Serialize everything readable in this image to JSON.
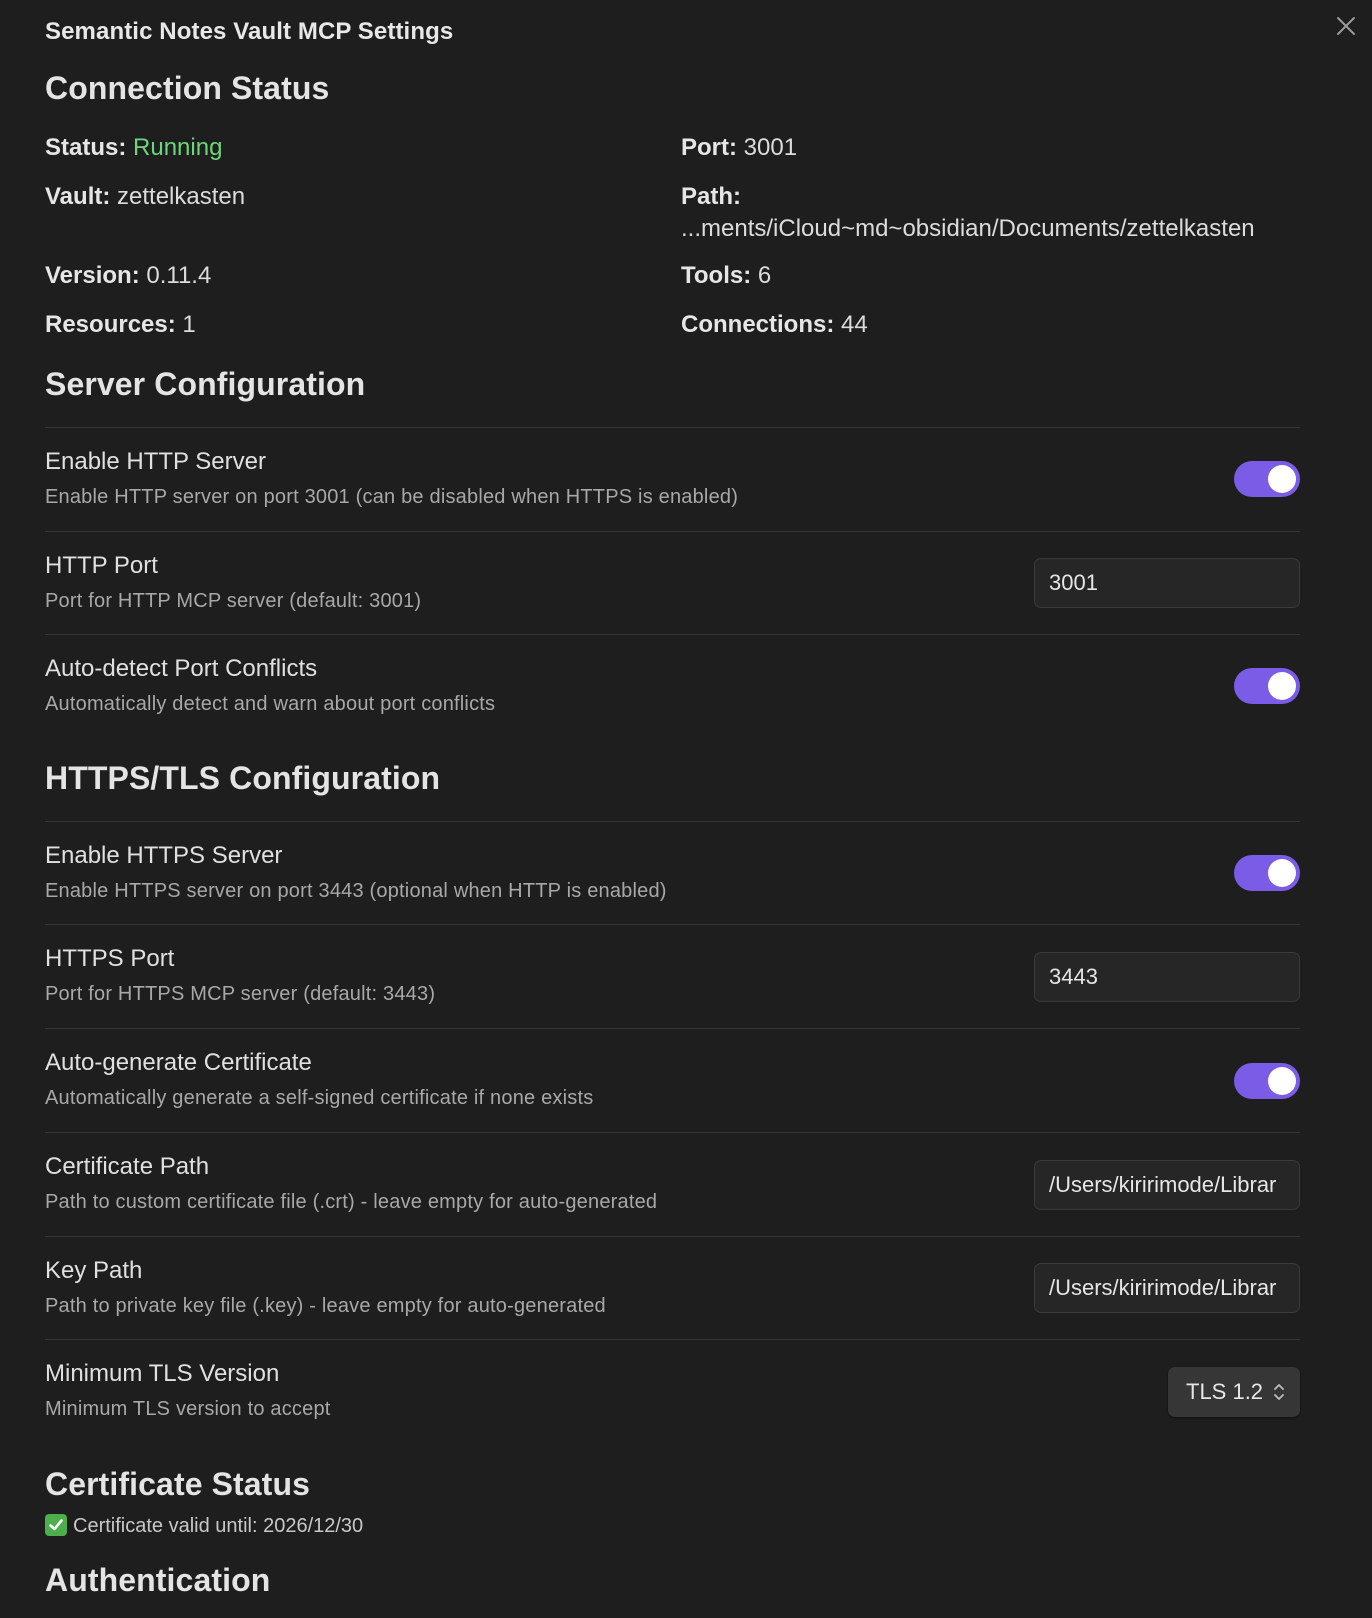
{
  "modal": {
    "title": "Semantic Notes Vault MCP Settings"
  },
  "connection_status": {
    "heading": "Connection Status",
    "status_label": "Status:",
    "status_value": "Running",
    "port_label": "Port:",
    "port_value": "3001",
    "vault_label": "Vault:",
    "vault_value": "zettelkasten",
    "path_label": "Path:",
    "path_value": "...ments/iCloud~md~obsidian/Documents/zettelkasten",
    "version_label": "Version:",
    "version_value": "0.11.4",
    "tools_label": "Tools:",
    "tools_value": "6",
    "resources_label": "Resources:",
    "resources_value": "1",
    "connections_label": "Connections:",
    "connections_value": "44"
  },
  "server_config": {
    "heading": "Server Configuration",
    "enable_http": {
      "name": "Enable HTTP Server",
      "desc": "Enable HTTP server on port 3001 (can be disabled when HTTPS is enabled)",
      "enabled": true
    },
    "http_port": {
      "name": "HTTP Port",
      "desc": "Port for HTTP MCP server (default: 3001)",
      "value": "3001"
    },
    "auto_detect": {
      "name": "Auto-detect Port Conflicts",
      "desc": "Automatically detect and warn about port conflicts",
      "enabled": true
    }
  },
  "https_config": {
    "heading": "HTTPS/TLS Configuration",
    "enable_https": {
      "name": "Enable HTTPS Server",
      "desc": "Enable HTTPS server on port 3443 (optional when HTTP is enabled)",
      "enabled": true
    },
    "https_port": {
      "name": "HTTPS Port",
      "desc": "Port for HTTPS MCP server (default: 3443)",
      "value": "3443"
    },
    "auto_cert": {
      "name": "Auto-generate Certificate",
      "desc": "Automatically generate a self-signed certificate if none exists",
      "enabled": true
    },
    "cert_path": {
      "name": "Certificate Path",
      "desc": "Path to custom certificate file (.crt) - leave empty for auto-generated",
      "value": "/Users/kiririmode/Librar"
    },
    "key_path": {
      "name": "Key Path",
      "desc": "Path to private key file (.key) - leave empty for auto-generated",
      "value": "/Users/kiririmode/Librar"
    },
    "min_tls": {
      "name": "Minimum TLS Version",
      "desc": "Minimum TLS version to accept",
      "value": "TLS 1.2"
    }
  },
  "certificate_status": {
    "heading": "Certificate Status",
    "text": "Certificate valid until: 2026/12/30"
  },
  "authentication": {
    "heading": "Authentication"
  },
  "colors": {
    "background": "#1e1e1e",
    "accent_toggle": "#7b5ce6",
    "status_running": "#6cd67a",
    "check": "#4cae4c"
  }
}
